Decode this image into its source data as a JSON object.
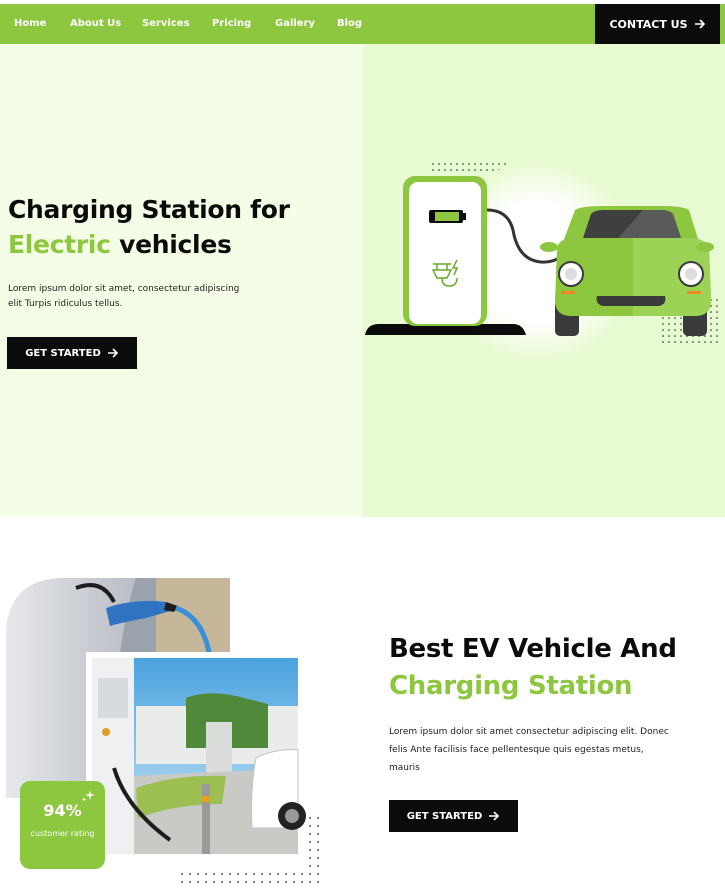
{
  "nav": {
    "items": [
      "Home",
      "About Us",
      "Services",
      "Pricing",
      "Gallery",
      "Blog"
    ],
    "contact_label": "CONTACT US"
  },
  "hero": {
    "title_line1": "Charging Station for",
    "title_highlight": "Electric",
    "title_rest": "vehicles",
    "text": "Lorem ipsum dolor sit amet, consectetur adipiscing elit Turpis ridiculus tellus.",
    "button_label": "GET STARTED"
  },
  "about": {
    "title_line1": "Best EV Vehicle And",
    "title_line2": "Charging Station",
    "text": "Lorem ipsum dolor sit amet consectetur adipiscing elit. Donec felis Ante facilisis face pellentesque quis egestas metus, mauris",
    "button_label": "GET STARTED",
    "rating_value": "94%",
    "rating_label": "customer rating"
  },
  "colors": {
    "brand_green": "#8dc63f",
    "dark": "#0b0b0b"
  },
  "icons": {
    "arrow": "arrow-right-icon",
    "sparkle": "sparkle-icon"
  }
}
